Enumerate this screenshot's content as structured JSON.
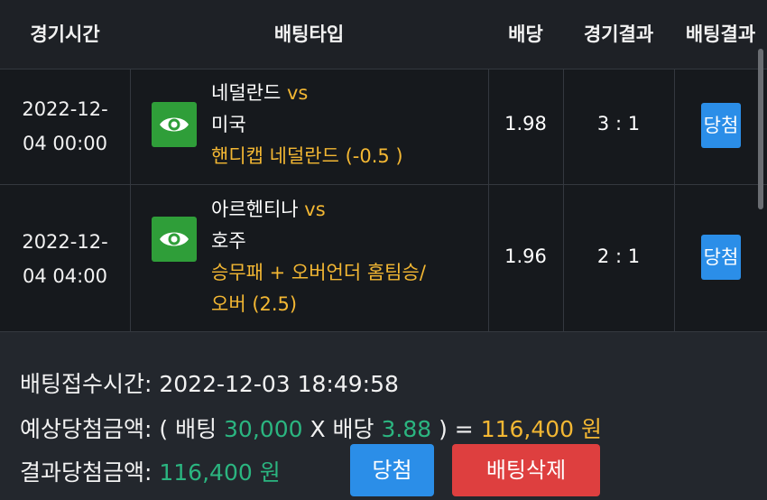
{
  "header": {
    "col_time": "경기시간",
    "col_type": "배팅타입",
    "col_odds": "배당",
    "col_result": "경기결과",
    "col_bet_result": "배팅결과"
  },
  "rows": [
    {
      "date_line1": "2022-12-",
      "date_line2": "04 00:00",
      "home": "네덜란드",
      "vs": "vs",
      "away": "미국",
      "bet_line1": "핸디캡 네덜란드 (-0.5 )",
      "bet_line2": "",
      "odds": "1.98",
      "score": "3 : 1",
      "badge": "당첨",
      "icon": "eye-icon"
    },
    {
      "date_line1": "2022-12-",
      "date_line2": "04 04:00",
      "home": "아르헨티나",
      "vs": "vs",
      "away": "호주",
      "bet_line1": "승무패 + 오버언더 홈팀승/",
      "bet_line2": "오버 (2.5)",
      "odds": "1.96",
      "score": "2 : 1",
      "badge": "당첨",
      "icon": "eye-icon"
    }
  ],
  "summary": {
    "receipt_label": "배팅접수시간: ",
    "receipt_time": "2022-12-03 18:49:58",
    "expected_label": "예상당첨금액: ( 배팅 ",
    "bet_amount": "30,000",
    "times_label": " X 배당 ",
    "total_odds": "3.88",
    "equals": " ) = ",
    "expected_amount": "116,400 원",
    "result_label": "결과당첨금액: ",
    "result_amount": "116,400 원",
    "win_button": "당첨",
    "delete_button": "배팅삭제"
  },
  "colors": {
    "accent_gold": "#f3b733",
    "accent_green": "#2bb580",
    "badge_blue": "#2b8ee8",
    "delete_red": "#de3f3f",
    "icon_green": "#2f9e39"
  }
}
